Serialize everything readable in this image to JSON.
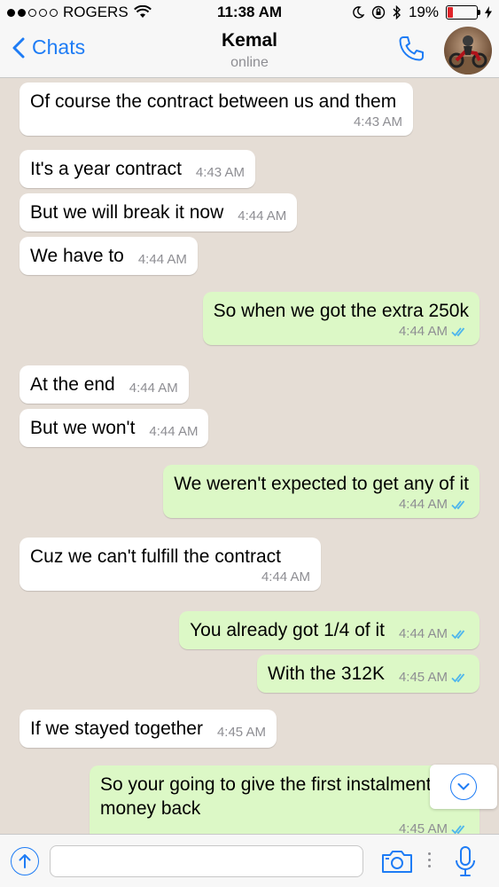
{
  "status_bar": {
    "carrier": "ROGERS",
    "time": "11:38 AM",
    "battery": "19%"
  },
  "header": {
    "back_label": "Chats",
    "contact_name": "Kemal",
    "contact_status": "online"
  },
  "colors": {
    "accent": "#1e7cf5",
    "outgoing_bubble": "#dcf8c6",
    "incoming_bubble": "#ffffff",
    "chat_background": "#e5ddd5",
    "read_ticks": "#4fb6ec"
  },
  "messages": [
    {
      "dir": "in",
      "text": "Of course the contract between us and them",
      "time": "4:43 AM"
    },
    {
      "dir": "in",
      "text": "It's a year contract",
      "time": "4:43 AM"
    },
    {
      "dir": "in",
      "text": "But we will break it now",
      "time": "4:44 AM"
    },
    {
      "dir": "in",
      "text": "We have to",
      "time": "4:44 AM"
    },
    {
      "dir": "out",
      "text": "So when we got the extra 250k",
      "time": "4:44 AM"
    },
    {
      "dir": "in",
      "text": "At the end",
      "time": "4:44 AM"
    },
    {
      "dir": "in",
      "text": "But we won't",
      "time": "4:44 AM"
    },
    {
      "dir": "out",
      "text": "We weren't expected to get any of it",
      "time": "4:44 AM"
    },
    {
      "dir": "in",
      "text": "Cuz we can't fulfill the contract",
      "time": "4:44 AM"
    },
    {
      "dir": "out",
      "text": "You already got 1/4 of it",
      "time": "4:44 AM"
    },
    {
      "dir": "out",
      "text": "With the 312K",
      "time": "4:45 AM"
    },
    {
      "dir": "in",
      "text": "If we stayed together",
      "time": "4:45 AM"
    },
    {
      "dir": "out",
      "text": "So your going to give the first instalment money back",
      "time": "4:45 AM"
    }
  ],
  "input": {
    "placeholder": ""
  },
  "icons": {
    "back": "chevron-left-icon",
    "call": "phone-icon",
    "attach": "upload-arrow-icon",
    "camera": "camera-icon",
    "mic": "microphone-icon",
    "scroll": "chevron-down-icon"
  }
}
